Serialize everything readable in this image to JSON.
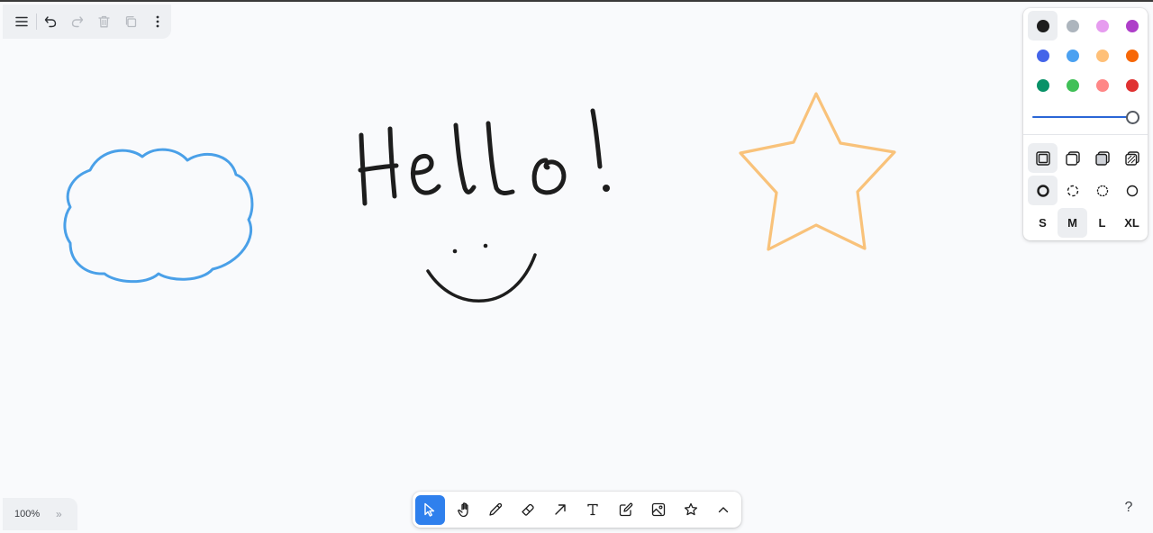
{
  "app": {
    "menu_icons": [
      "menu-icon",
      "undo-icon",
      "redo-icon",
      "trash-icon",
      "duplicate-icon",
      "more-icon"
    ]
  },
  "canvas": {
    "shapes": [
      {
        "type": "cloud",
        "color": "#4aa0e8"
      },
      {
        "type": "handwriting",
        "text": "Hello!",
        "color": "#1d1d1d"
      },
      {
        "type": "smiley",
        "color": "#1d1d1d"
      },
      {
        "type": "star",
        "color": "#f9c27a"
      }
    ]
  },
  "style_panel": {
    "colors": [
      {
        "name": "black",
        "hex": "#1d1d1d",
        "selected": true
      },
      {
        "name": "grey",
        "hex": "#adb5bd"
      },
      {
        "name": "light-violet",
        "hex": "#e69cef"
      },
      {
        "name": "violet",
        "hex": "#ae3ec9"
      },
      {
        "name": "blue",
        "hex": "#4465e9"
      },
      {
        "name": "light-blue",
        "hex": "#4ba1f1"
      },
      {
        "name": "yellow",
        "hex": "#ffc078"
      },
      {
        "name": "orange",
        "hex": "#f76707"
      },
      {
        "name": "green",
        "hex": "#099268"
      },
      {
        "name": "light-green",
        "hex": "#40c057"
      },
      {
        "name": "light-red",
        "hex": "#ff8787"
      },
      {
        "name": "red",
        "hex": "#e03131"
      }
    ],
    "opacity": 1.0,
    "fill_options": [
      "fill-none-icon",
      "fill-semi-icon",
      "fill-solid-icon",
      "fill-pattern-icon"
    ],
    "dash_options": [
      "dash-draw-icon",
      "dash-dashed-icon",
      "dash-dotted-icon",
      "dash-solid-icon"
    ],
    "sizes": [
      "S",
      "M",
      "L",
      "XL"
    ],
    "selected_size": "M"
  },
  "zoom": {
    "level": "100%",
    "expand_label": "»"
  },
  "toolbar": {
    "tools": [
      "select",
      "hand",
      "draw",
      "eraser",
      "arrow",
      "text",
      "note",
      "asset",
      "star",
      "more"
    ],
    "active": "select"
  },
  "help": {
    "label": "?"
  }
}
